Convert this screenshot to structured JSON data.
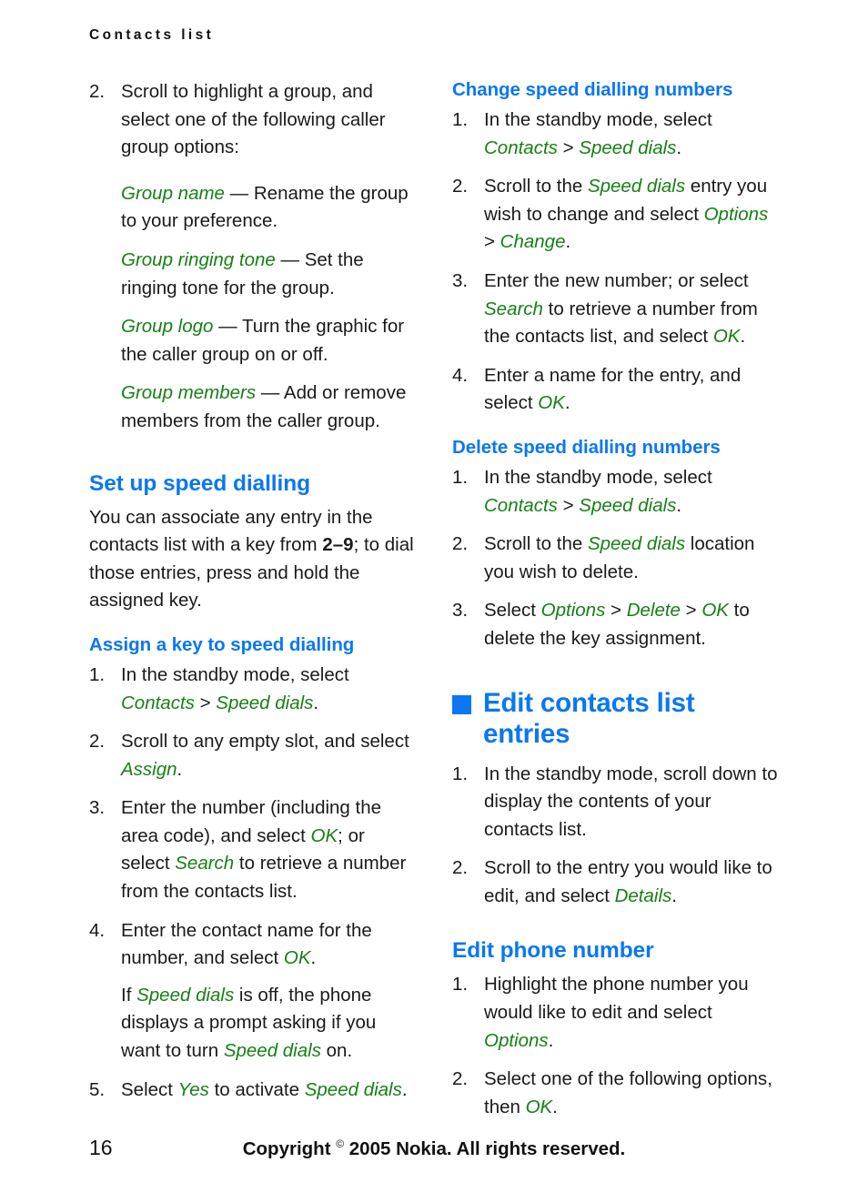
{
  "running_head": "Contacts list",
  "left_column": {
    "step2": {
      "num": "2.",
      "text": "Scroll to highlight a group, and select one of the following caller group options:"
    },
    "definitions": [
      {
        "term": "Group name",
        "dash": "—",
        "desc": "Rename the group to your preference."
      },
      {
        "term": "Group ringing tone",
        "dash": "—",
        "desc": "Set the ringing tone for the group."
      },
      {
        "term": "Group logo",
        "dash": "—",
        "desc": "Turn the graphic for the caller group on or off."
      },
      {
        "term": "Group members",
        "dash": "—",
        "desc": "Add or remove members from the caller group."
      }
    ],
    "heading_setup": "Set up speed dialling",
    "intro_part1": "You can associate any entry in the contacts list with a key from ",
    "intro_keys": "2–9",
    "intro_part2": "; to dial those entries, press and hold the assigned key.",
    "heading_assign": "Assign a key to speed dialling",
    "assign_steps": [
      {
        "num": "1.",
        "pre": "In the standby mode, select ",
        "ui1": "Contacts",
        "sep": " > ",
        "ui2": "Speed dials",
        "post": "."
      },
      {
        "num": "2.",
        "pre": "Scroll to any empty slot, and select ",
        "ui1": "Assign",
        "post": "."
      },
      {
        "num": "3.",
        "pre": "Enter the number (including the area code), and select ",
        "ui1": "OK",
        "mid": "; or select ",
        "ui2": "Search",
        "post": " to retrieve a number from the contacts list."
      },
      {
        "num": "4.",
        "pre": "Enter the contact name for the number, and select ",
        "ui1": "OK",
        "post": ".",
        "sub_pre": "If ",
        "sub_ui1": "Speed dials",
        "sub_mid": " is off, the phone displays a prompt asking if you want to turn ",
        "sub_ui2": "Speed dials",
        "sub_post": " on."
      },
      {
        "num": "5.",
        "pre": "Select ",
        "ui1": "Yes",
        "mid": " to activate ",
        "ui2": "Speed dials",
        "post": "."
      }
    ]
  },
  "right_column": {
    "heading_change": "Change speed dialling numbers",
    "change_steps": [
      {
        "num": "1.",
        "pre": "In the standby mode, select ",
        "ui1": "Contacts",
        "sep": " > ",
        "ui2": "Speed dials",
        "post": "."
      },
      {
        "num": "2.",
        "pre": "Scroll to the ",
        "ui1": "Speed dials",
        "mid": " entry you wish to change and select ",
        "ui2": "Options",
        "sep2": " > ",
        "ui3": "Change",
        "post": "."
      },
      {
        "num": "3.",
        "pre": "Enter the new number; or select ",
        "ui1": "Search",
        "mid": " to retrieve a number from the contacts list, and select ",
        "ui2": "OK",
        "post": "."
      },
      {
        "num": "4.",
        "pre": "Enter a name for the entry, and select ",
        "ui1": "OK",
        "post": "."
      }
    ],
    "heading_delete": "Delete speed dialling numbers",
    "delete_steps": [
      {
        "num": "1.",
        "pre": "In the standby mode, select ",
        "ui1": "Contacts",
        "sep": " > ",
        "ui2": "Speed dials",
        "post": "."
      },
      {
        "num": "2.",
        "pre": "Scroll to the ",
        "ui1": "Speed dials",
        "mid": " location you wish to delete.",
        "post": ""
      },
      {
        "num": "3.",
        "pre": "Select ",
        "ui1": "Options",
        "sep": " > ",
        "ui2": "Delete",
        "sep2": " > ",
        "ui3": "OK",
        "post": " to delete the key assignment."
      }
    ],
    "section_title": "Edit contacts list entries",
    "edit_steps": [
      {
        "num": "1.",
        "pre": "In the standby mode, scroll down to display the contents of your contacts list.",
        "post": ""
      },
      {
        "num": "2.",
        "pre": "Scroll to the entry you would like to edit, and select ",
        "ui1": "Details",
        "post": "."
      }
    ],
    "heading_editphone": "Edit phone number",
    "editphone_steps": [
      {
        "num": "1.",
        "pre": "Highlight the phone number you would like to edit and select ",
        "ui1": "Options",
        "post": "."
      },
      {
        "num": "2.",
        "pre": "Select one of the following options, then ",
        "ui1": "OK",
        "post": "."
      }
    ]
  },
  "footer": {
    "page_number": "16",
    "copyright_pre": "Copyright ",
    "copyright_symbol": "©",
    "copyright_post": " 2005 Nokia. All rights reserved."
  },
  "colors": {
    "heading_blue": "#0a77f2",
    "ui_green": "#168016",
    "body_black": "#1a1a1a"
  }
}
